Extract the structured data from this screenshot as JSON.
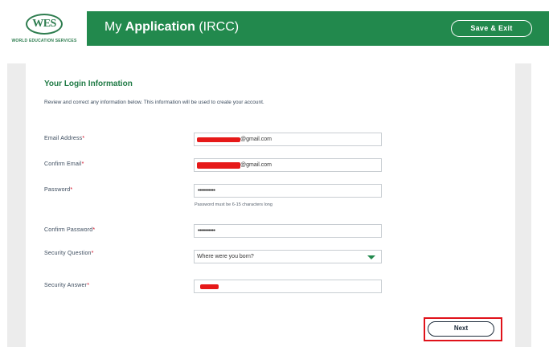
{
  "header": {
    "logo_text": "WES",
    "logo_subtitle": "WORLD EDUCATION SERVICES",
    "title_prefix": "My ",
    "title_bold": "Application",
    "title_suffix": " (IRCC)",
    "save_exit_label": "Save & Exit"
  },
  "form": {
    "section_title": "Your Login Information",
    "description": "Review and correct any information below. This information will be used to create your account.",
    "required_marker": "*",
    "fields": {
      "email": {
        "label": "Email Address",
        "value_suffix": "@gmail.com"
      },
      "confirm_email": {
        "label": "Confirm Email",
        "value_suffix": "@gmail.com"
      },
      "password": {
        "label": "Password",
        "value": "•••••••••••",
        "hint": "Password must be 6-15 characters long"
      },
      "confirm_password": {
        "label": "Confirm Password",
        "value": "•••••••••••"
      },
      "security_question": {
        "label": "Security Question",
        "value": "Where were you born?"
      },
      "security_answer": {
        "label": "Security Answer"
      }
    },
    "next_label": "Next"
  },
  "colors": {
    "brand_green": "#22894d",
    "accent_red": "#e0121a"
  },
  "icons": {
    "dropdown": "chevron-down-icon"
  }
}
